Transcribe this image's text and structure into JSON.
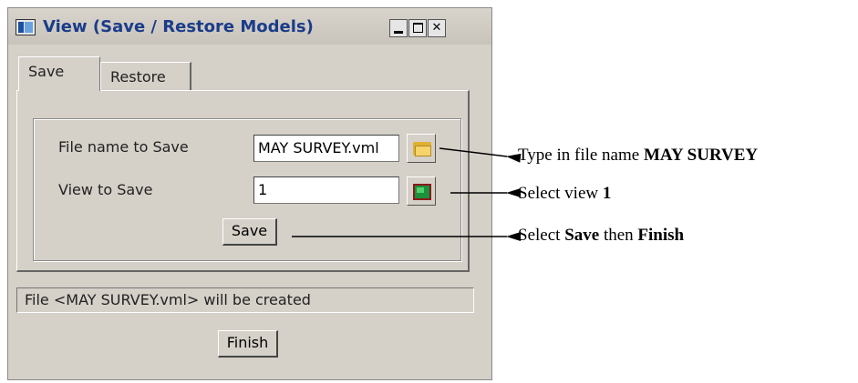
{
  "window": {
    "title": "View (Save / Restore Models)"
  },
  "tabs": [
    {
      "label": "Save",
      "active": true
    },
    {
      "label": "Restore",
      "active": false
    }
  ],
  "form": {
    "file_label": "File name to Save",
    "file_value": "MAY SURVEY.vml",
    "view_label": "View to Save",
    "view_value": "1",
    "save_label": "Save"
  },
  "status": "File <MAY SURVEY.vml> will be created",
  "finish_label": "Finish",
  "annotations": [
    {
      "before": "Type in file name ",
      "bold": "MAY SURVEY",
      "after": "",
      "bold2": ""
    },
    {
      "before": "Select view ",
      "bold": "1",
      "after": "",
      "bold2": ""
    },
    {
      "before": "Select ",
      "bold": "Save",
      "after": " then ",
      "bold2": "Finish"
    }
  ],
  "icons": {
    "app": "app-window-icon",
    "browse": "folder-icon",
    "view_pick": "view-select-icon"
  }
}
